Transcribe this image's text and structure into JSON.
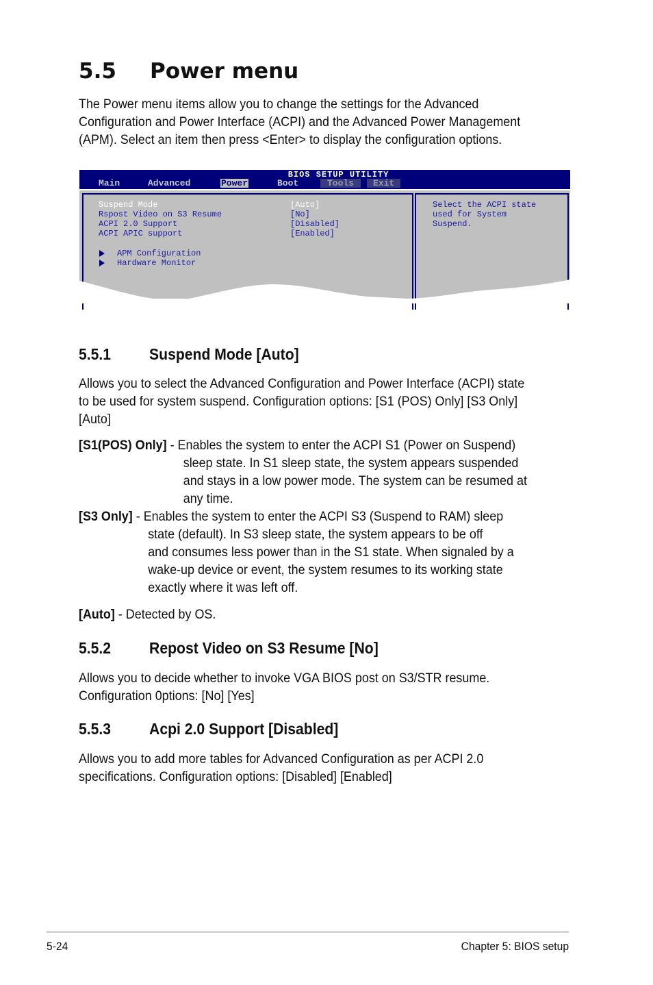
{
  "section": {
    "number": "5.5",
    "title": "Power menu",
    "intro": [
      "The Power menu items allow you to change the settings for the Advanced",
      "Configuration and Power Interface (ACPI) and the Advanced Power Management",
      "(APM). Select an item then press <Enter> to display the configuration options."
    ]
  },
  "bios": {
    "title": "BIOS SETUP UTILITY",
    "tabs": [
      {
        "label": "Main",
        "state": "normal"
      },
      {
        "label": "Advanced",
        "state": "normal"
      },
      {
        "label": "Power",
        "state": "active"
      },
      {
        "label": "Boot",
        "state": "normal"
      },
      {
        "label": "Tools",
        "state": "dim"
      },
      {
        "label": "Exit",
        "state": "dim"
      }
    ],
    "items": [
      {
        "label": "Suspend Mode",
        "value": "[Auto]",
        "selected": true
      },
      {
        "label": "Rspost Video on S3 Resume",
        "value": "[No]",
        "selected": false
      },
      {
        "label": "ACPI 2.0 Support",
        "value": "[Disabled]",
        "selected": false
      },
      {
        "label": "ACPI APIC support",
        "value": "[Enabled]",
        "selected": false
      }
    ],
    "submenus": [
      {
        "label": "APM Configuration",
        "icon": "triangle-right-icon"
      },
      {
        "label": "Hardware Monitor",
        "icon": "triangle-right-icon"
      }
    ],
    "help_text": [
      "Select the ACPI state",
      "used for System",
      "Suspend."
    ],
    "colors": {
      "header_bg": "#00007b",
      "panel_bg": "#c0c0c0",
      "text": "#1a1aa0",
      "selected_text": "#ffffff"
    }
  },
  "subsections": [
    {
      "number": "5.5.1",
      "title": "Suspend Mode [Auto]",
      "body": [
        "Allows you to select the Advanced Configuration and Power Interface (ACPI) state",
        "to be used for system suspend. Configuration options: [S1 (POS) Only] [S3 Only]",
        "[Auto]"
      ],
      "options": [
        {
          "term": "[S1(POS) Only]",
          "lines": [
            "Enables the system to enter the ACPI S1 (Power on Suspend)",
            "sleep state. In S1 sleep state, the system appears suspended",
            "and stays in a low power mode. The system can be resumed at",
            "any time."
          ]
        },
        {
          "term": "[S3 Only]",
          "lines": [
            "Enables the system to enter the ACPI S3 (Suspend to RAM) sleep",
            "state (default). In S3 sleep state, the system appears to be off",
            "and consumes less power than in the S1 state. When signaled by a",
            "wake-up device or event, the system resumes to its working state",
            "exactly where it was left off."
          ]
        },
        {
          "term": "[Auto]",
          "lines": [
            "Detected by OS."
          ]
        }
      ]
    },
    {
      "number": "5.5.2",
      "title": "Repost Video on S3 Resume [No]",
      "body": [
        "Allows you to decide whether to invoke VGA BIOS post on S3/STR resume.",
        "Configuration 0ptions: [No] [Yes]"
      ]
    },
    {
      "number": "5.5.3",
      "title": "Acpi 2.0 Support [Disabled]",
      "body": [
        "Allows you to add more tables for Advanced Configuration as per ACPI 2.0",
        "specifications. Configuration options: [Disabled] [Enabled]"
      ]
    }
  ],
  "footer": {
    "page_number": "5-24",
    "chapter": "Chapter 5: BIOS setup"
  }
}
